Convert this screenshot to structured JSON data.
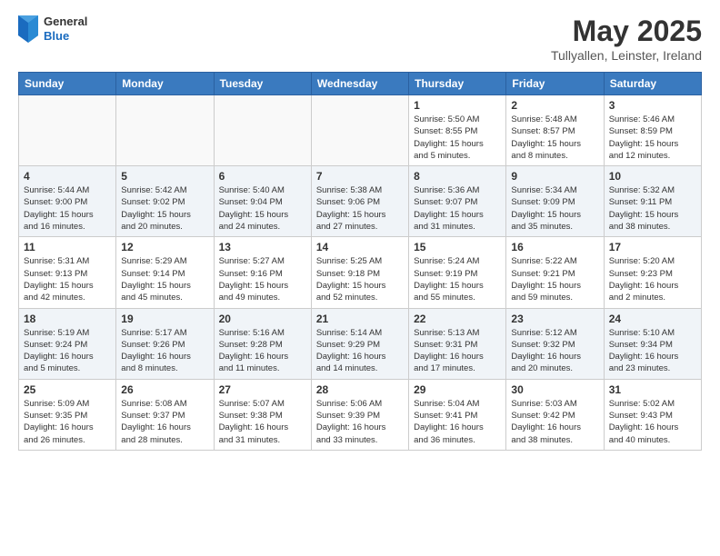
{
  "header": {
    "logo_general": "General",
    "logo_blue": "Blue",
    "month_year": "May 2025",
    "location": "Tullyallen, Leinster, Ireland"
  },
  "days_of_week": [
    "Sunday",
    "Monday",
    "Tuesday",
    "Wednesday",
    "Thursday",
    "Friday",
    "Saturday"
  ],
  "weeks": [
    {
      "days": [
        {
          "num": "",
          "info": ""
        },
        {
          "num": "",
          "info": ""
        },
        {
          "num": "",
          "info": ""
        },
        {
          "num": "",
          "info": ""
        },
        {
          "num": "1",
          "info": "Sunrise: 5:50 AM\nSunset: 8:55 PM\nDaylight: 15 hours\nand 5 minutes."
        },
        {
          "num": "2",
          "info": "Sunrise: 5:48 AM\nSunset: 8:57 PM\nDaylight: 15 hours\nand 8 minutes."
        },
        {
          "num": "3",
          "info": "Sunrise: 5:46 AM\nSunset: 8:59 PM\nDaylight: 15 hours\nand 12 minutes."
        }
      ]
    },
    {
      "days": [
        {
          "num": "4",
          "info": "Sunrise: 5:44 AM\nSunset: 9:00 PM\nDaylight: 15 hours\nand 16 minutes."
        },
        {
          "num": "5",
          "info": "Sunrise: 5:42 AM\nSunset: 9:02 PM\nDaylight: 15 hours\nand 20 minutes."
        },
        {
          "num": "6",
          "info": "Sunrise: 5:40 AM\nSunset: 9:04 PM\nDaylight: 15 hours\nand 24 minutes."
        },
        {
          "num": "7",
          "info": "Sunrise: 5:38 AM\nSunset: 9:06 PM\nDaylight: 15 hours\nand 27 minutes."
        },
        {
          "num": "8",
          "info": "Sunrise: 5:36 AM\nSunset: 9:07 PM\nDaylight: 15 hours\nand 31 minutes."
        },
        {
          "num": "9",
          "info": "Sunrise: 5:34 AM\nSunset: 9:09 PM\nDaylight: 15 hours\nand 35 minutes."
        },
        {
          "num": "10",
          "info": "Sunrise: 5:32 AM\nSunset: 9:11 PM\nDaylight: 15 hours\nand 38 minutes."
        }
      ]
    },
    {
      "days": [
        {
          "num": "11",
          "info": "Sunrise: 5:31 AM\nSunset: 9:13 PM\nDaylight: 15 hours\nand 42 minutes."
        },
        {
          "num": "12",
          "info": "Sunrise: 5:29 AM\nSunset: 9:14 PM\nDaylight: 15 hours\nand 45 minutes."
        },
        {
          "num": "13",
          "info": "Sunrise: 5:27 AM\nSunset: 9:16 PM\nDaylight: 15 hours\nand 49 minutes."
        },
        {
          "num": "14",
          "info": "Sunrise: 5:25 AM\nSunset: 9:18 PM\nDaylight: 15 hours\nand 52 minutes."
        },
        {
          "num": "15",
          "info": "Sunrise: 5:24 AM\nSunset: 9:19 PM\nDaylight: 15 hours\nand 55 minutes."
        },
        {
          "num": "16",
          "info": "Sunrise: 5:22 AM\nSunset: 9:21 PM\nDaylight: 15 hours\nand 59 minutes."
        },
        {
          "num": "17",
          "info": "Sunrise: 5:20 AM\nSunset: 9:23 PM\nDaylight: 16 hours\nand 2 minutes."
        }
      ]
    },
    {
      "days": [
        {
          "num": "18",
          "info": "Sunrise: 5:19 AM\nSunset: 9:24 PM\nDaylight: 16 hours\nand 5 minutes."
        },
        {
          "num": "19",
          "info": "Sunrise: 5:17 AM\nSunset: 9:26 PM\nDaylight: 16 hours\nand 8 minutes."
        },
        {
          "num": "20",
          "info": "Sunrise: 5:16 AM\nSunset: 9:28 PM\nDaylight: 16 hours\nand 11 minutes."
        },
        {
          "num": "21",
          "info": "Sunrise: 5:14 AM\nSunset: 9:29 PM\nDaylight: 16 hours\nand 14 minutes."
        },
        {
          "num": "22",
          "info": "Sunrise: 5:13 AM\nSunset: 9:31 PM\nDaylight: 16 hours\nand 17 minutes."
        },
        {
          "num": "23",
          "info": "Sunrise: 5:12 AM\nSunset: 9:32 PM\nDaylight: 16 hours\nand 20 minutes."
        },
        {
          "num": "24",
          "info": "Sunrise: 5:10 AM\nSunset: 9:34 PM\nDaylight: 16 hours\nand 23 minutes."
        }
      ]
    },
    {
      "days": [
        {
          "num": "25",
          "info": "Sunrise: 5:09 AM\nSunset: 9:35 PM\nDaylight: 16 hours\nand 26 minutes."
        },
        {
          "num": "26",
          "info": "Sunrise: 5:08 AM\nSunset: 9:37 PM\nDaylight: 16 hours\nand 28 minutes."
        },
        {
          "num": "27",
          "info": "Sunrise: 5:07 AM\nSunset: 9:38 PM\nDaylight: 16 hours\nand 31 minutes."
        },
        {
          "num": "28",
          "info": "Sunrise: 5:06 AM\nSunset: 9:39 PM\nDaylight: 16 hours\nand 33 minutes."
        },
        {
          "num": "29",
          "info": "Sunrise: 5:04 AM\nSunset: 9:41 PM\nDaylight: 16 hours\nand 36 minutes."
        },
        {
          "num": "30",
          "info": "Sunrise: 5:03 AM\nSunset: 9:42 PM\nDaylight: 16 hours\nand 38 minutes."
        },
        {
          "num": "31",
          "info": "Sunrise: 5:02 AM\nSunset: 9:43 PM\nDaylight: 16 hours\nand 40 minutes."
        }
      ]
    }
  ]
}
